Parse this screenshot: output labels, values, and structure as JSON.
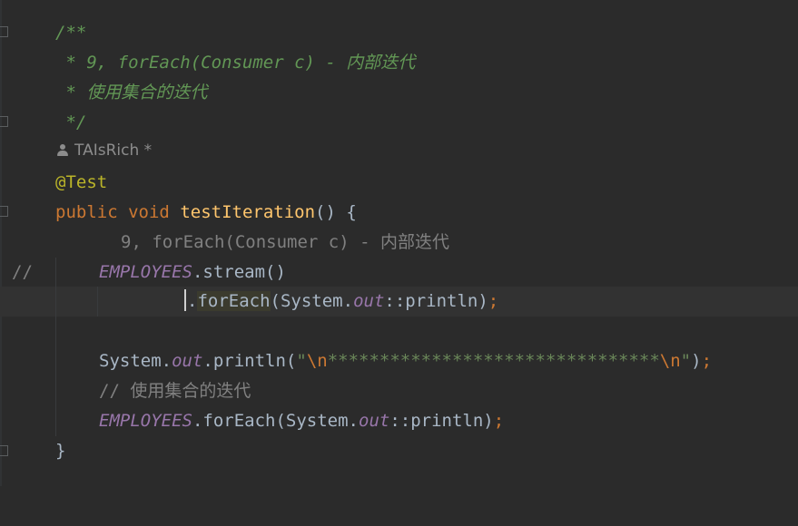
{
  "editor": {
    "doc_open": "/**",
    "doc_line1": " * 9, forEach(Consumer c) - 内部迭代",
    "doc_line2": " * 使用集合的迭代",
    "doc_close": " */",
    "author": "TAIsRich *",
    "annotation": "@Test",
    "kw_public": "public",
    "kw_void": "void",
    "method_name": "testIteration",
    "sig_rest": "() {",
    "commented_marker": "//",
    "commented_text": "9, forEach(Consumer c) - 内部迭代",
    "employees": "EMPLOYEES",
    "stream_call": ".stream()",
    "dot": ".",
    "for_each": "forEach",
    "system": "System",
    "out": "out",
    "println_ref": "::println)",
    "semicolon": ";",
    "println_call": ".println(",
    "quote": "\"",
    "esc_n": "\\n",
    "stars": "********************************",
    "str_end_paren": ")",
    "comment2": "// 使用集合的迭代",
    "for_each_call": ".forEach(",
    "close_brace": "}"
  },
  "colors": {
    "background": "#2b2b2b",
    "keyword": "#cc7832",
    "method": "#ffc66d",
    "doc_comment": "#629755",
    "static_field": "#9876aa",
    "string": "#6a8759"
  }
}
